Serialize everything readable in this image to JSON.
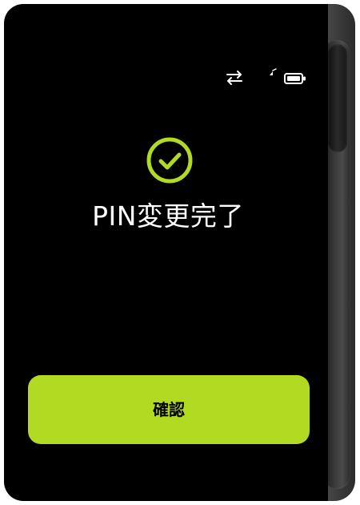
{
  "screen": {
    "title": "PIN変更完了",
    "confirm_label": "確認"
  },
  "status_bar": {
    "icons": [
      "transfer-icon",
      "signal-icon",
      "battery-icon"
    ]
  },
  "icons": {
    "success": "checkmark-circle-icon"
  },
  "colors": {
    "screen_background": "#000000",
    "accent": "#b3da22",
    "title_text": "#ffffff",
    "button_text": "#000000",
    "device_side": "#3a3a3a"
  }
}
